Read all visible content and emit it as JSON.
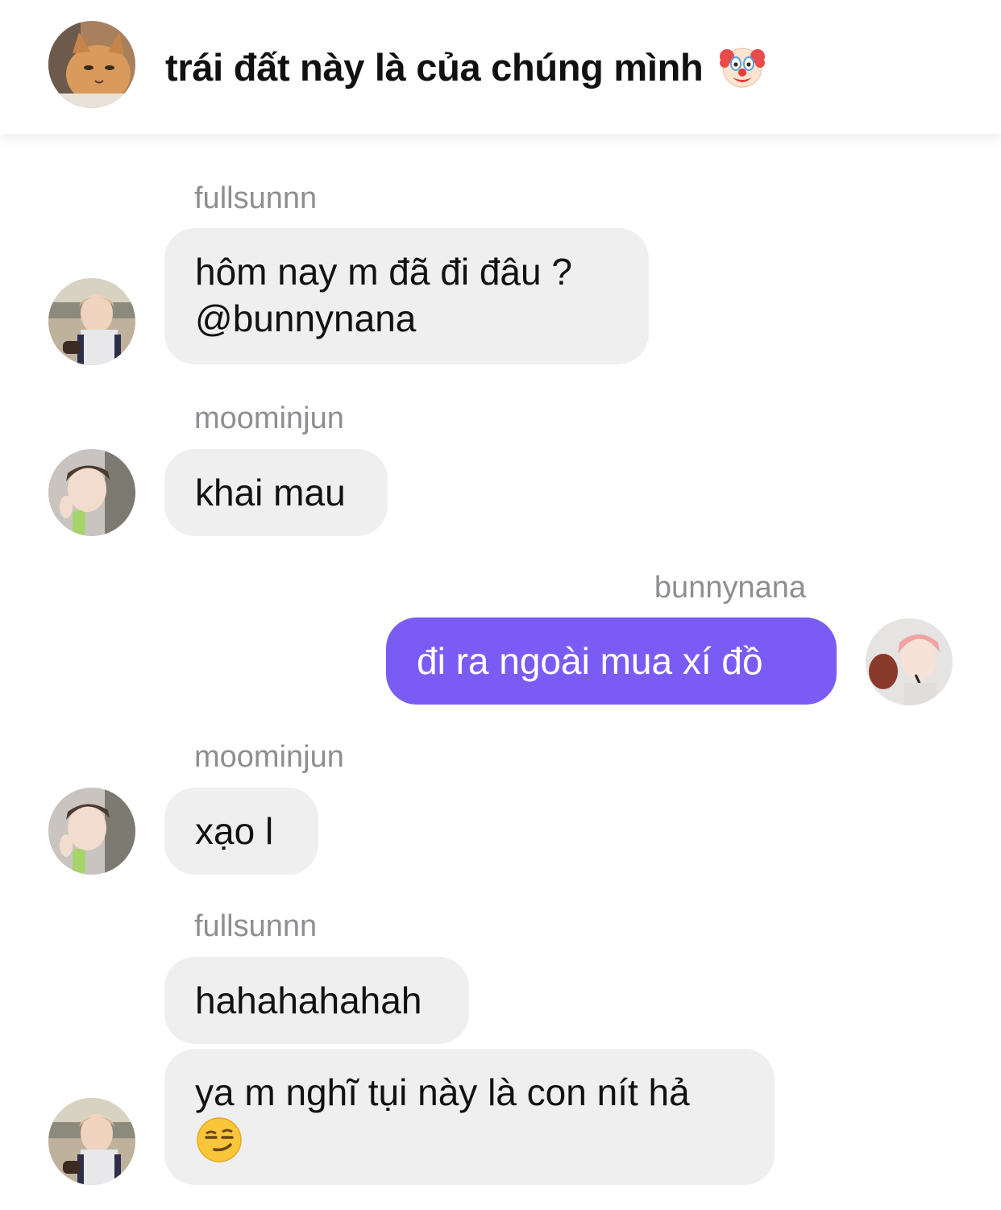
{
  "conversation": {
    "title": "trái đất này là của chúng mình",
    "title_emoji": "clown-face-emoji"
  },
  "messages": [
    {
      "sender": "fullsunnn",
      "lines": [
        "hôm nay m đã đi đâu ?",
        "@bunnynana"
      ],
      "mine": false
    },
    {
      "sender": "moominjun",
      "lines": [
        "khai mau"
      ],
      "mine": false
    },
    {
      "sender": "bunnynana",
      "lines": [
        "đi ra ngoài mua xí đồ"
      ],
      "mine": true
    },
    {
      "sender": "moominjun",
      "lines": [
        "xạo l"
      ],
      "mine": false
    },
    {
      "sender": "fullsunnn",
      "lines": [
        "hahahahahah"
      ],
      "mine": false
    },
    {
      "sender": "",
      "lines": [
        "ya m nghĩ tụi này là con nít hả"
      ],
      "trailing_emoji": "smirking-face-emoji",
      "mine": false
    }
  ],
  "colors": {
    "my_bubble": "#7a5cf5",
    "their_bubble": "#efefef",
    "sender_name": "#8e8e93"
  }
}
